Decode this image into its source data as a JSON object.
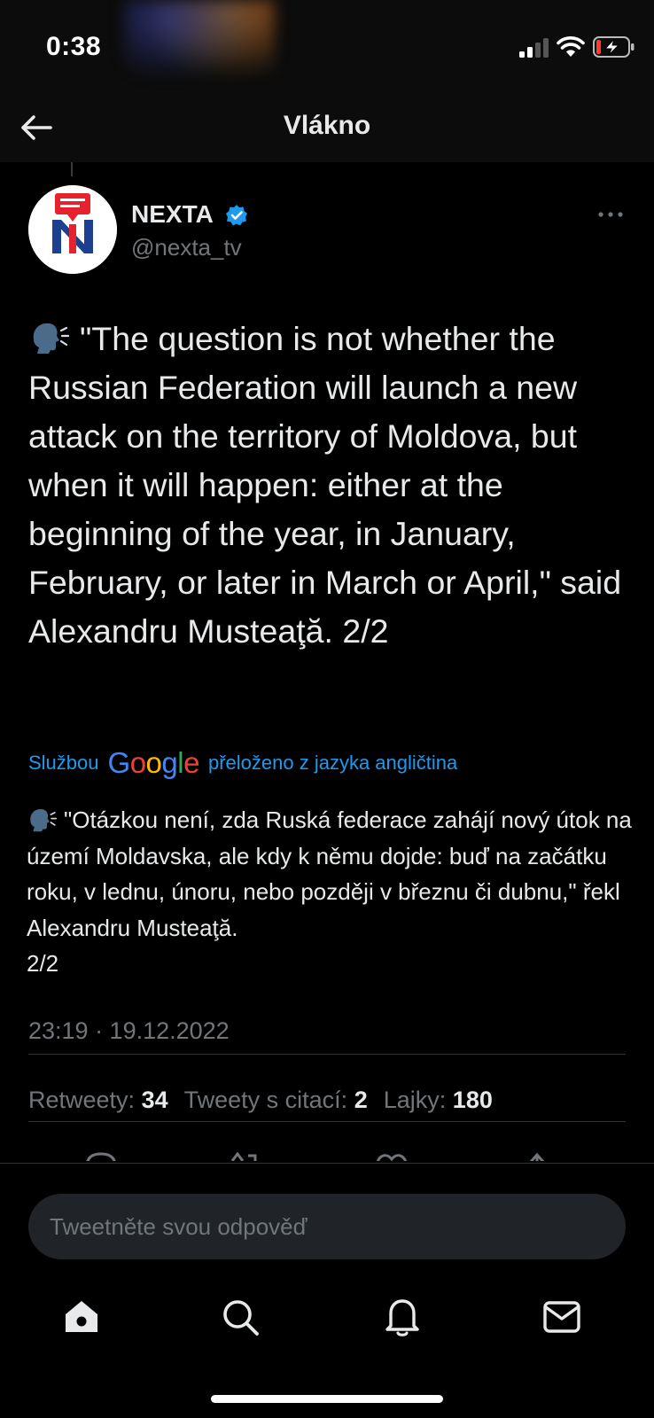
{
  "status_bar": {
    "time": "0:38",
    "signal_icon": "cellular-signal-icon",
    "wifi_icon": "wifi-icon",
    "battery_icon": "battery-charging-icon",
    "battery_level": 0.15
  },
  "header": {
    "title": "Vlákno",
    "back_icon": "arrow-left-icon"
  },
  "tweet": {
    "author_name": "NEXTA",
    "author_handle": "@nexta_tv",
    "verified": true,
    "text": "\"The question is not whether the Russian Federation will launch a new attack on the territory of Moldova, but when it will happen: either at the beginning of the year, in January, February, or later in March or April,\" said Alexandru Musteaţă. 2/2",
    "emoji": "speaking-head-emoji",
    "translation_prefix": "Službou",
    "translation_brand": "Google",
    "translation_suffix": "přeloženo z jazyka angličtina",
    "translated_text": "\"Otázkou není, zda Ruská federace zahájí nový útok na území Moldavska, ale kdy k němu dojde: buď na začátku roku, v lednu, únoru, nebo později v březnu či dubnu,\" řekl Alexandru Musteaţă.\n2/2",
    "timestamp": "23:19 · 19.12.2022"
  },
  "stats": {
    "retweets_label": "Retweety:",
    "retweets_value": "34",
    "quotes_label": "Tweety s citací:",
    "quotes_value": "2",
    "likes_label": "Lajky:",
    "likes_value": "180"
  },
  "reply": {
    "placeholder": "Tweetněte svou odpověď"
  },
  "tab_bar": {
    "items": [
      "home-icon",
      "search-icon",
      "notifications-icon",
      "messages-icon"
    ]
  },
  "colors": {
    "background": "#000000",
    "accent": "#1d9bf0",
    "muted": "#71767b",
    "text": "#e7e9ea"
  }
}
